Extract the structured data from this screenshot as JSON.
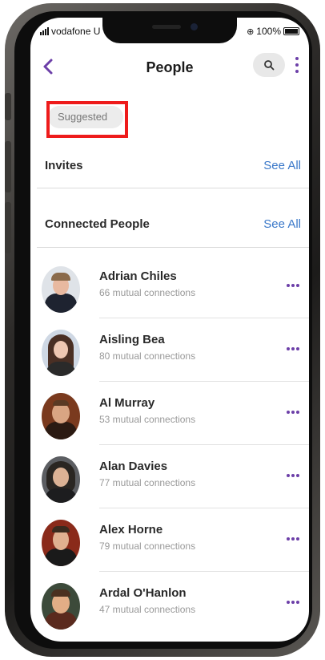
{
  "status_bar": {
    "carrier": "vodafone U",
    "battery": "100%"
  },
  "header": {
    "title": "People"
  },
  "filter": {
    "suggested_label": "Suggested"
  },
  "sections": {
    "invites": {
      "label": "Invites",
      "see_all": "See All"
    },
    "connected": {
      "label": "Connected People",
      "see_all": "See All"
    }
  },
  "people": [
    {
      "name": "Adrian Chiles",
      "mutual": "66 mutual connections"
    },
    {
      "name": "Aisling Bea",
      "mutual": "80 mutual connections"
    },
    {
      "name": "Al Murray",
      "mutual": "53 mutual connections"
    },
    {
      "name": "Alan Davies",
      "mutual": "77 mutual connections"
    },
    {
      "name": "Alex Horne",
      "mutual": "79 mutual connections"
    },
    {
      "name": "Ardal O'Hanlon",
      "mutual": "47 mutual connections"
    }
  ],
  "colors": {
    "accent": "#6c3fa8",
    "link": "#3a78c9",
    "highlight": "#ee1b1b"
  }
}
